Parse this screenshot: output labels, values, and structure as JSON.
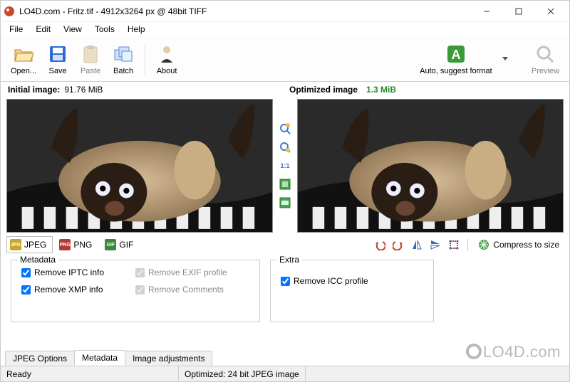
{
  "window": {
    "title": "LO4D.com - Fritz.tif - 4912x3264 px @ 48bit TIFF"
  },
  "menu": {
    "file": "File",
    "edit": "Edit",
    "view": "View",
    "tools": "Tools",
    "help": "Help"
  },
  "toolbar": {
    "open": "Open...",
    "save": "Save",
    "paste": "Paste",
    "batch": "Batch",
    "about": "About",
    "auto": "Auto, suggest format",
    "preview": "Preview"
  },
  "sizes": {
    "initial_label": "Initial image:",
    "initial_value": "91.76 MiB",
    "optimized_label": "Optimized image",
    "optimized_value": "1.3 MiB"
  },
  "midtools": {
    "zoomin": "zoom-in",
    "zoomout": "zoom-out",
    "onetoone": "1:1",
    "fit": "fit",
    "fit2": "actual"
  },
  "format_tabs": {
    "jpeg": "JPEG",
    "png": "PNG",
    "gif": "GIF"
  },
  "actions": {
    "undo": "undo",
    "redo": "redo",
    "fliph": "flip-h",
    "flipv": "flip-v",
    "crop": "crop",
    "compress": "Compress to size"
  },
  "groups": {
    "metadata_title": "Metadata",
    "extra_title": "Extra",
    "remove_iptc": "Remove IPTC info",
    "remove_xmp": "Remove XMP info",
    "remove_exif": "Remove EXIF profile",
    "remove_comments": "Remove Comments",
    "remove_icc": "Remove ICC profile"
  },
  "bottom_tabs": {
    "jpeg_options": "JPEG Options",
    "metadata": "Metadata",
    "image_adjustments": "Image adjustments"
  },
  "status": {
    "ready": "Ready",
    "optimized": "Optimized: 24 bit JPEG image"
  },
  "watermark": "LO4D.com"
}
